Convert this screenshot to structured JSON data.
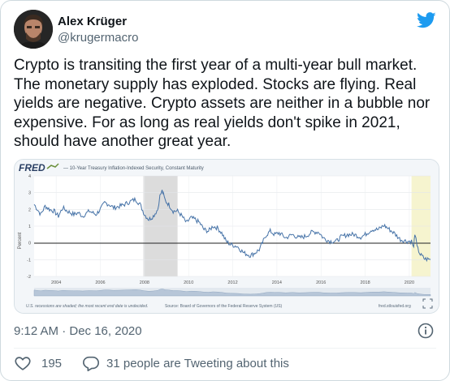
{
  "author": {
    "name": "Alex Krüger",
    "handle": "@krugermacro"
  },
  "tweet": {
    "text": "Crypto is transiting the first year of a multi-year bull market. The monetary supply has exploded. Stocks are flying. Real yields are negative. Crypto assets are neither in a bubble nor expensive. For as long as real yields don't spike in 2021, should have another great year."
  },
  "chart": {
    "logo": "FRED",
    "series_label": "— 10-Year Treasury Inflation-Indexed Security, Constant Maturity",
    "ylabel": "Percent",
    "footer_left": "U.S. recessions are shaded; the most recent end date is undecided.",
    "footer_source": "Source: Board of Governors of the Federal Reserve System (US)",
    "footer_right": "fred.stlouisfed.org",
    "colors": {
      "line": "#4572a7",
      "recession": "#dcdcdc",
      "recent": "#f6f4cf"
    }
  },
  "chart_data": {
    "type": "line",
    "title": "10-Year Treasury Inflation-Indexed Security, Constant Maturity",
    "xlabel": "",
    "ylabel": "Percent",
    "x_ticks": [
      "2004",
      "2006",
      "2008",
      "2010",
      "2012",
      "2014",
      "2016",
      "2018",
      "2020"
    ],
    "y_ticks": [
      "-2",
      "-1",
      "0",
      "1",
      "2",
      "3",
      "4"
    ],
    "ylim": [
      -2,
      4
    ],
    "xlim": [
      2003.0,
      2020.96
    ],
    "recessions": [
      [
        2007.95,
        2009.5
      ],
      [
        2020.1,
        2020.96
      ]
    ],
    "series": [
      {
        "x": [
          2003.0,
          2003.1,
          2003.3,
          2003.5,
          2003.7,
          2003.9,
          2004.1,
          2004.3,
          2004.5,
          2004.8,
          2005.0,
          2005.2,
          2005.5,
          2005.8,
          2006.0,
          2006.2,
          2006.4,
          2006.6,
          2006.9,
          2007.1,
          2007.4,
          2007.6,
          2007.8,
          2008.0,
          2008.2,
          2008.4,
          2008.6,
          2008.7,
          2008.8,
          2008.85,
          2008.95,
          2009.1,
          2009.3,
          2009.5,
          2009.7,
          2009.9,
          2010.1,
          2010.3,
          2010.5,
          2010.7,
          2010.9,
          2011.1,
          2011.3,
          2011.5,
          2011.7,
          2011.9,
          2012.2,
          2012.5,
          2012.8,
          2013.0,
          2013.2,
          2013.35,
          2013.5,
          2013.7,
          2013.9,
          2014.1,
          2014.4,
          2014.7,
          2015.0,
          2015.3,
          2015.6,
          2015.9,
          2016.1,
          2016.4,
          2016.7,
          2016.9,
          2017.2,
          2017.5,
          2017.8,
          2018.0,
          2018.3,
          2018.6,
          2018.85,
          2019.0,
          2019.3,
          2019.6,
          2019.9,
          2020.1,
          2020.2,
          2020.25,
          2020.35,
          2020.5,
          2020.7,
          2020.96
        ],
        "y": [
          2.3,
          2.1,
          1.7,
          2.2,
          2.0,
          1.9,
          1.6,
          2.1,
          1.9,
          1.7,
          1.8,
          1.6,
          1.9,
          1.7,
          2.0,
          2.4,
          2.3,
          2.1,
          2.2,
          2.3,
          2.5,
          2.6,
          2.3,
          1.7,
          1.4,
          1.6,
          2.0,
          2.8,
          3.1,
          2.9,
          2.5,
          2.3,
          1.9,
          1.9,
          1.6,
          1.2,
          1.5,
          1.4,
          1.2,
          0.8,
          0.7,
          1.0,
          0.9,
          0.6,
          0.1,
          -0.1,
          -0.2,
          -0.6,
          -0.75,
          -0.6,
          -0.4,
          0.0,
          0.45,
          0.7,
          0.5,
          0.6,
          0.3,
          0.5,
          0.3,
          0.4,
          0.65,
          0.65,
          0.3,
          0.1,
          0.1,
          0.35,
          0.5,
          0.5,
          0.35,
          0.5,
          0.8,
          0.8,
          1.05,
          0.9,
          0.6,
          0.2,
          0.1,
          0.1,
          -0.3,
          0.6,
          -0.25,
          -0.7,
          -0.95,
          -1.0
        ]
      }
    ]
  },
  "meta": {
    "timestamp": "9:12 AM · Dec 16, 2020",
    "likes": "195",
    "tweeting": "31 people are Tweeting about this"
  }
}
